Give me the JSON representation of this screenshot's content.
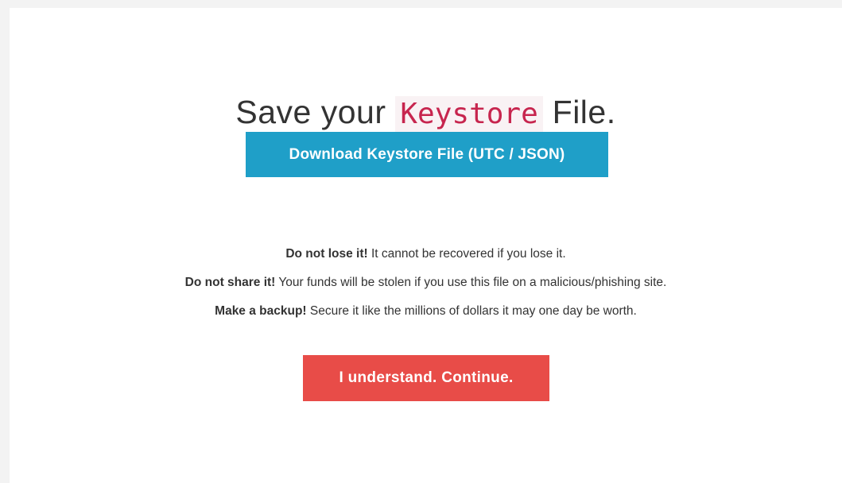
{
  "title": {
    "prefix": "Save your ",
    "highlight": "Keystore",
    "suffix": " File."
  },
  "download_button": {
    "label": "Download Keystore File (UTC / JSON)"
  },
  "warnings": [
    {
      "bold": "Do not lose it!",
      "text": " It cannot be recovered if you lose it."
    },
    {
      "bold": "Do not share it!",
      "text": " Your funds will be stolen if you use this file on a malicious/phishing site."
    },
    {
      "bold": "Make a backup!",
      "text": " Secure it like the millions of dollars it may one day be worth."
    }
  ],
  "continue_button": {
    "label": "I understand. Continue."
  },
  "colors": {
    "download_button": "#1f9fc8",
    "continue_button": "#e84c48",
    "highlight_text": "#c7254e",
    "highlight_background": "#f9f2f4"
  }
}
